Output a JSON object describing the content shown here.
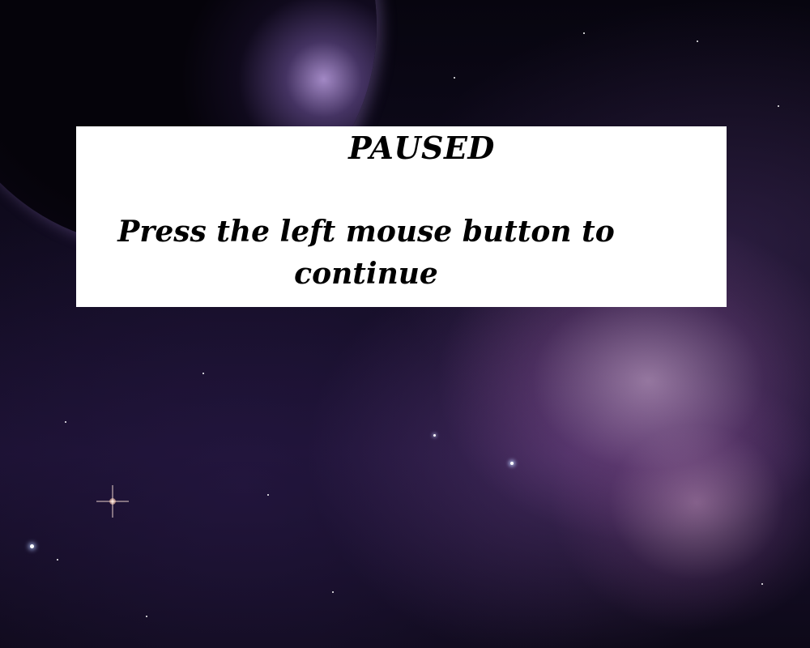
{
  "pause_screen": {
    "title": "PAUSED",
    "message": "Press the left mouse button to continue"
  },
  "background": {
    "scene": "space-nebula",
    "panel_color": "#ffffff",
    "text_color": "#000000"
  }
}
